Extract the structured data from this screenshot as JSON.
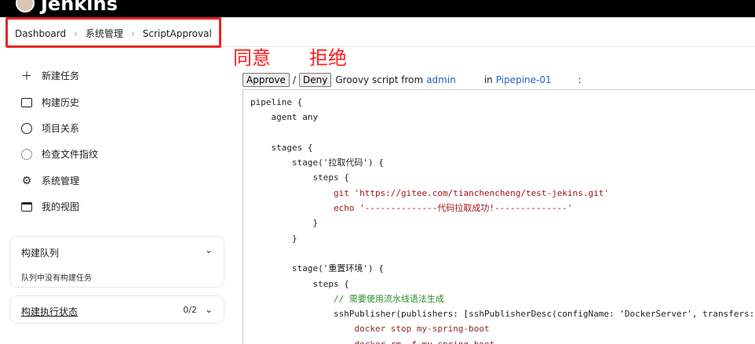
{
  "header": {
    "brand": "Jenkins"
  },
  "breadcrumb": {
    "items": [
      "Dashboard",
      "系统管理",
      "ScriptApproval"
    ],
    "separator": "›"
  },
  "annotations": {
    "approve_note": "同意",
    "deny_note": "拒绝",
    "color": "#ff1c1c"
  },
  "sidebar": {
    "items": [
      {
        "label": "新建任务",
        "icon": "plus-icon"
      },
      {
        "label": "构建历史",
        "icon": "history-icon"
      },
      {
        "label": "项目关系",
        "icon": "relationship-icon"
      },
      {
        "label": "检查文件指纹",
        "icon": "fingerprint-icon"
      },
      {
        "label": "系统管理",
        "icon": "gear-icon"
      },
      {
        "label": "我的视图",
        "icon": "window-icon"
      }
    ],
    "build_queue": {
      "title": "构建队列",
      "empty": "队列中没有构建任务"
    },
    "executor_status": {
      "title": "构建执行状态",
      "count": "0/2"
    }
  },
  "approval": {
    "approve_label": "Approve",
    "deny_label": "Deny",
    "slash": "/",
    "text_prefix": "Groovy script from",
    "user": "admin",
    "text_in": "in",
    "job": "Pipepine-01",
    "colon": ":"
  },
  "script": {
    "lines": [
      "pipeline {",
      "    agent any",
      "",
      "    stages {",
      "        stage('拉取代码') {",
      "            steps {",
      "                git 'https://gitee.com/tianchencheng/test-jekins.git'",
      "                echo '--------------代码拉取成功!--------------'",
      "            }",
      "        }",
      "",
      "        stage('重置环境') {",
      "            steps {",
      "                // 需要使用流水线语法生成",
      "                sshPublisher(publishers: [sshPublisherDesc(configName: 'DockerServer', transfers: [ss",
      "                    docker stop my-spring-boot",
      "                    docker rm -f my-spring-boot"
    ]
  }
}
